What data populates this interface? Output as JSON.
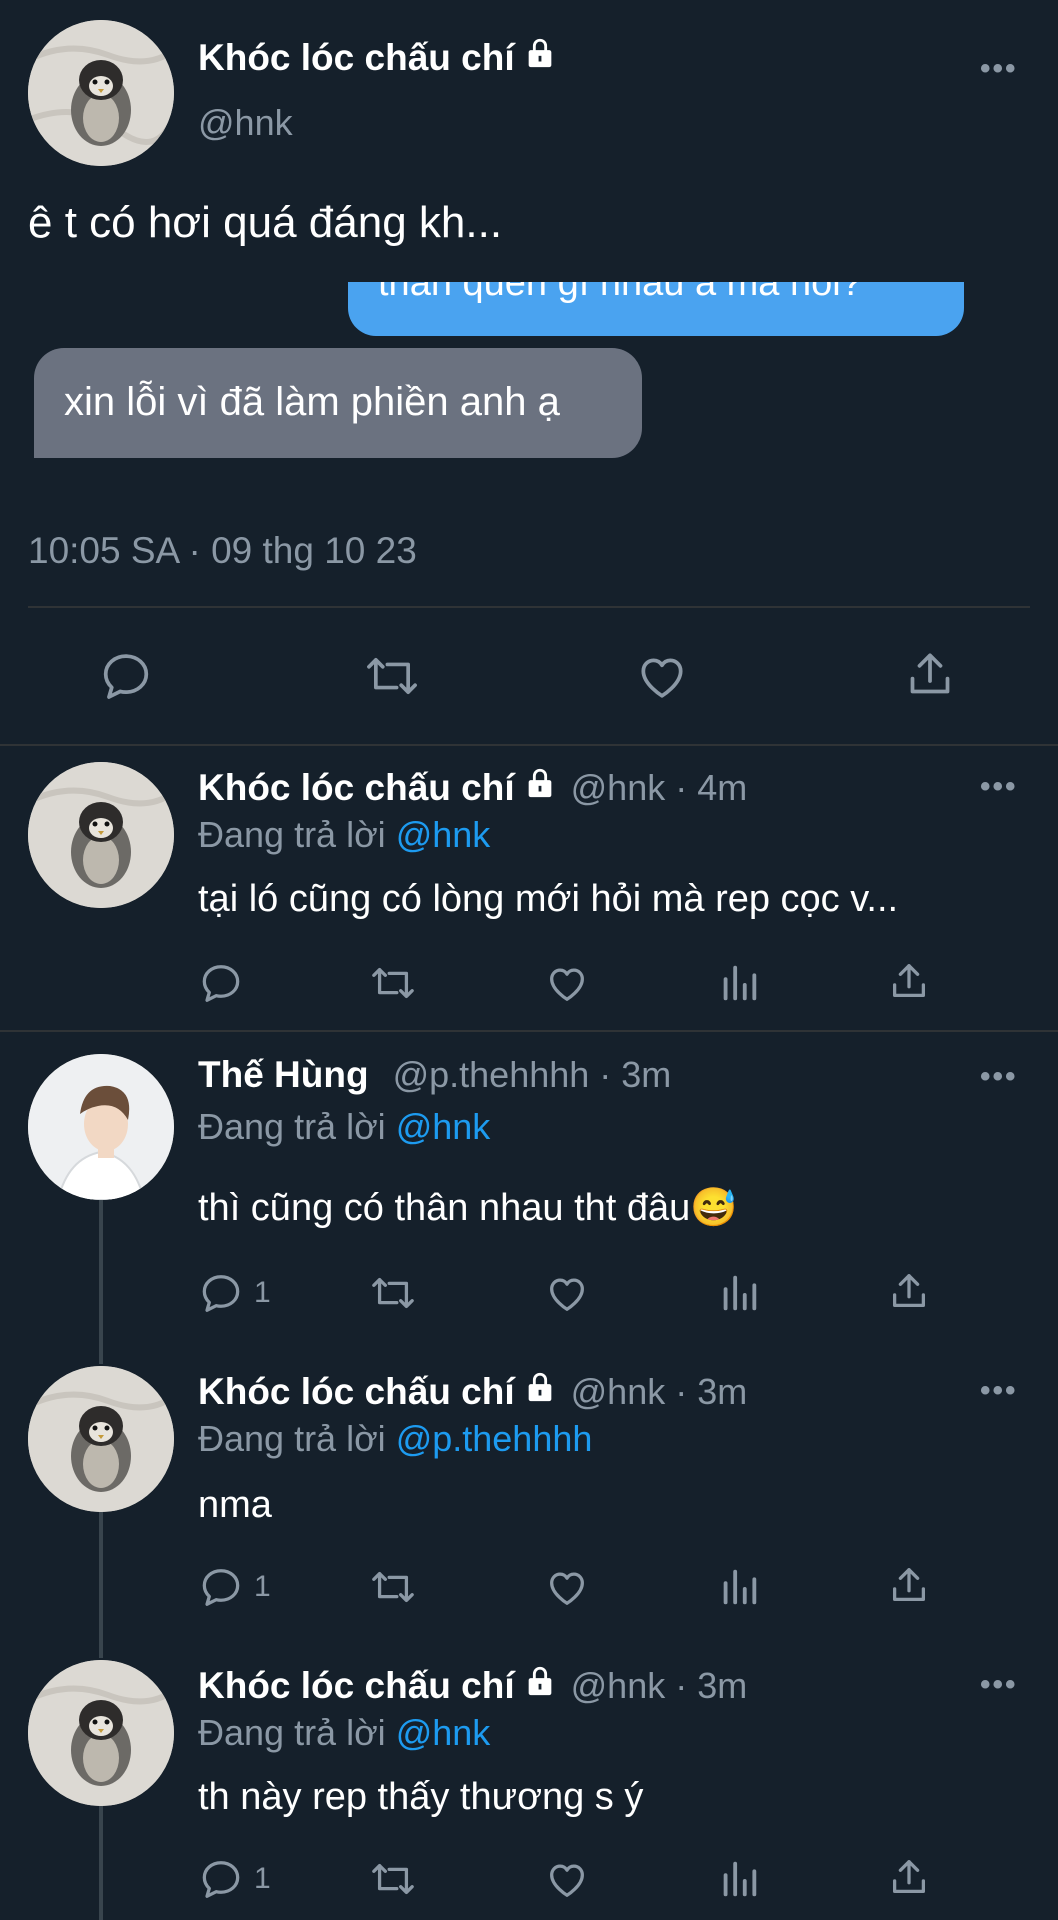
{
  "main_tweet": {
    "display_name": "Khóc lóc chấu chí",
    "handle": "@hnk",
    "text": "ê t có hơi quá đáng kh...",
    "image_bubbles": {
      "outgoing_partial": "thân quen gì nhau à mà hỏi?",
      "incoming": "xin lỗi vì đã làm phiền anh ạ"
    },
    "timestamp": "10:05 SA · 09 thg 10 23",
    "more": "•••"
  },
  "replies": [
    {
      "display_name": "Khóc lóc chấu chí",
      "handle_time": "@hnk · 4m",
      "replying_prefix": "Đang trả lời ",
      "replying_to": "@hnk",
      "text": "tại ló cũng có lòng mới hỏi mà rep cọc v...",
      "reply_count": "",
      "more": "•••"
    },
    {
      "display_name": "Thế Hùng",
      "handle_time": "@p.thehhhh · 3m",
      "replying_prefix": "Đang trả lời ",
      "replying_to": "@hnk",
      "text": "thì cũng có thân nhau tht đâu😅",
      "reply_count": "1",
      "more": "•••"
    },
    {
      "display_name": "Khóc lóc chấu chí",
      "handle_time": "@hnk · 3m",
      "replying_prefix": "Đang trả lời ",
      "replying_to": "@p.thehhhh",
      "text": "nma",
      "reply_count": "1",
      "more": "•••"
    },
    {
      "display_name": "Khóc lóc chấu chí",
      "handle_time": "@hnk · 3m",
      "replying_prefix": "Đang trả lời ",
      "replying_to": "@hnk",
      "text": "th này rep thấy thương s ý",
      "reply_count": "1",
      "more": "•••"
    }
  ],
  "icons": {
    "reply": "reply-icon",
    "retweet": "retweet-icon",
    "like": "like-icon",
    "views": "views-icon",
    "share": "share-icon",
    "lock": "lock-icon"
  },
  "colors": {
    "background": "#15202b",
    "secondary_text": "#8b98a5",
    "mention": "#1d9bf0",
    "outgoing_bubble": "#4aa3f0",
    "incoming_bubble": "#6b7280"
  }
}
